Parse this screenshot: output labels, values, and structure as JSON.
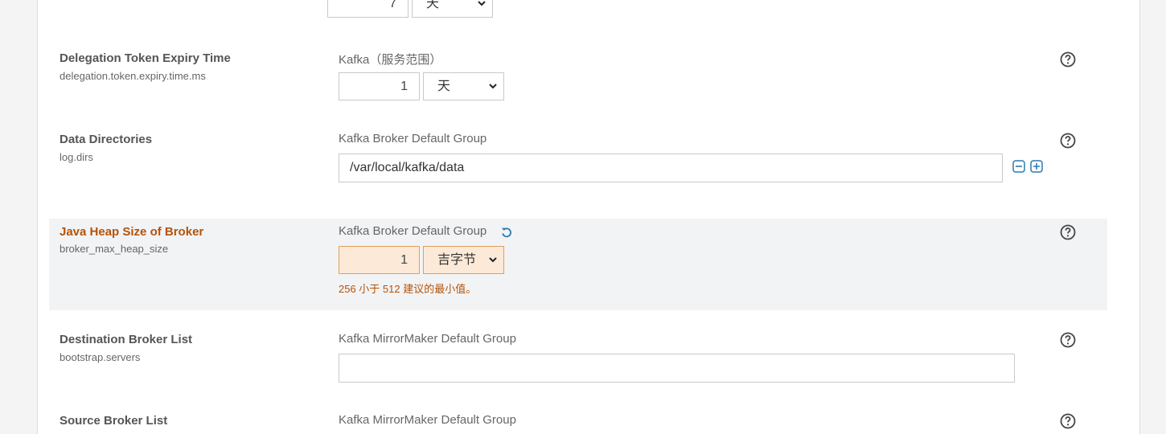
{
  "rows": [
    {
      "id": "prev",
      "number": "7",
      "unit": "天"
    },
    {
      "id": "delegation",
      "name": "Delegation Token Expiry Time",
      "key": "delegation.token.expiry.time.ms",
      "scope": "Kafka（服务范围）",
      "number": "1",
      "unit": "天"
    },
    {
      "id": "datadirs",
      "name": "Data Directories",
      "key": "log.dirs",
      "scope": "Kafka Broker Default Group",
      "value": "/var/local/kafka/data"
    },
    {
      "id": "heap",
      "name": "Java Heap Size of Broker",
      "key": "broker_max_heap_size",
      "scope": "Kafka Broker Default Group",
      "number": "1",
      "unit": "吉字节",
      "warning": "256 小于 512 建议的最小值。"
    },
    {
      "id": "destbroker",
      "name": "Destination Broker List",
      "key": "bootstrap.servers",
      "scope": "Kafka MirrorMaker Default Group",
      "value": ""
    },
    {
      "id": "srcbroker",
      "name": "Source Broker List",
      "scope": "Kafka MirrorMaker Default Group"
    }
  ],
  "colors": {
    "warning": "#b45309",
    "accent": "#2a7ab0",
    "warning_bg": "#fde9d7"
  }
}
